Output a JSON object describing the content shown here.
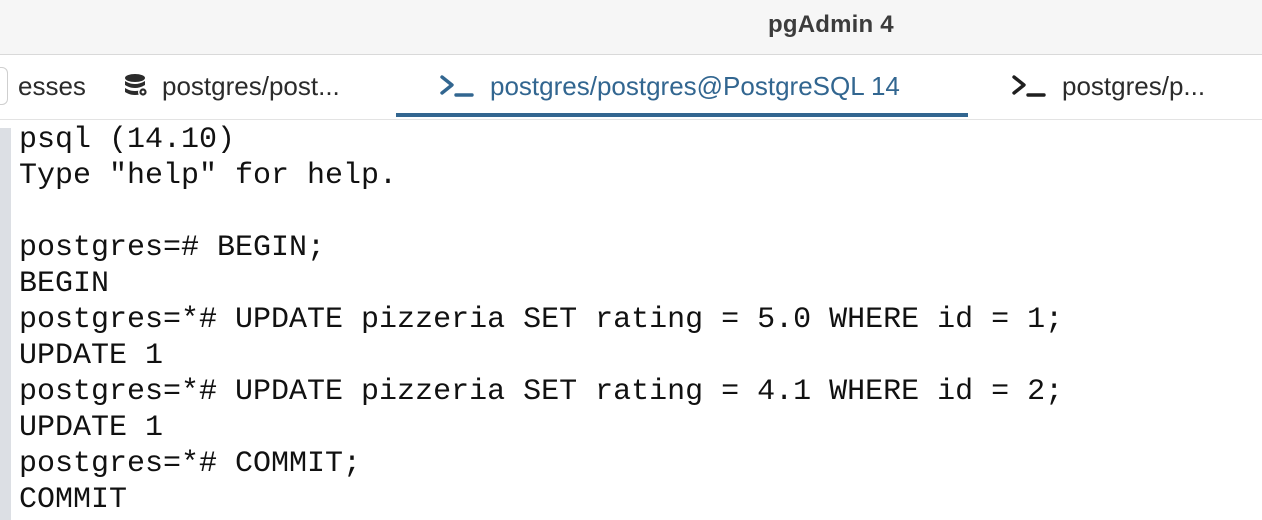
{
  "window": {
    "title": "pgAdmin 4"
  },
  "tabs": [
    {
      "label": "esses",
      "icon": "none",
      "active": false
    },
    {
      "label": "postgres/post...",
      "icon": "database-icon",
      "active": false
    },
    {
      "label": "postgres/postgres@PostgreSQL 14",
      "icon": "terminal-icon",
      "active": true
    },
    {
      "label": "postgres/p...",
      "icon": "terminal-icon",
      "active": false
    }
  ],
  "colors": {
    "accent": "#326690",
    "titlebar": "#f6f6f6",
    "text": "#111111"
  },
  "terminal": {
    "lines": [
      "psql (14.10)",
      "Type \"help\" for help.",
      "",
      "postgres=# BEGIN;",
      "BEGIN",
      "postgres=*# UPDATE pizzeria SET rating = 5.0 WHERE id = 1;",
      "UPDATE 1",
      "postgres=*# UPDATE pizzeria SET rating = 4.1 WHERE id = 2;",
      "UPDATE 1",
      "postgres=*# COMMIT;",
      "COMMIT"
    ]
  }
}
